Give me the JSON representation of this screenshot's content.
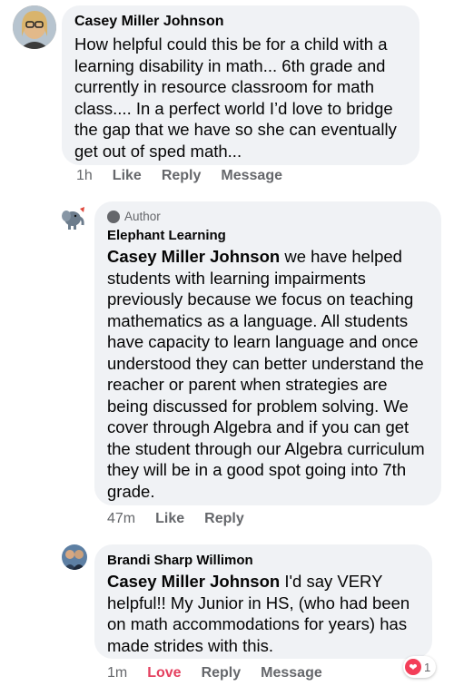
{
  "comments": [
    {
      "author": "Casey Miller Johnson",
      "text": "How helpful could this be for a child with a learning disability in math... 6th grade and currently in resource classroom for math class.... In a perfect world I’d love to bridge the gap that we have so she can eventually get out of sped math...",
      "time": "1h",
      "actions": [
        "Like",
        "Reply",
        "Message"
      ]
    },
    {
      "badge": "Author",
      "author": "Elephant Learning",
      "mention": "Casey Miller Johnson",
      "text": " we have helped students with learning impairments previously because we focus on teaching mathematics as a language. All students have capacity to learn language and once understood they can better understand the reacher or parent when strategies are being discussed for problem solving. We cover through Algebra and if you can get the student through our Algebra curriculum they will be in a good spot going into 7th grade.",
      "time": "47m",
      "actions": [
        "Like",
        "Reply"
      ]
    },
    {
      "author": "Brandi Sharp Willimon",
      "mention": "Casey Miller Johnson",
      "text": " I'd say VERY helpful!! My Junior in HS, (who had been on math accommodations for years) has made strides with this.",
      "time": "1m",
      "actions": [
        "Love",
        "Reply",
        "Message"
      ],
      "reaction_count": "1"
    }
  ],
  "colors": {
    "love": "#e4405f",
    "bubble": "#f0f2f5",
    "muted": "#65676b"
  }
}
